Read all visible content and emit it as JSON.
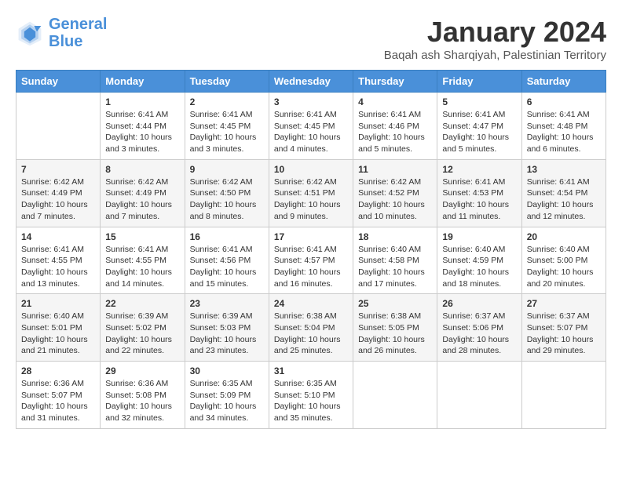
{
  "logo": {
    "line1": "General",
    "line2": "Blue"
  },
  "title": "January 2024",
  "location": "Baqah ash Sharqiyah, Palestinian Territory",
  "days_of_week": [
    "Sunday",
    "Monday",
    "Tuesday",
    "Wednesday",
    "Thursday",
    "Friday",
    "Saturday"
  ],
  "weeks": [
    [
      {
        "num": "",
        "info": ""
      },
      {
        "num": "1",
        "info": "Sunrise: 6:41 AM\nSunset: 4:44 PM\nDaylight: 10 hours\nand 3 minutes."
      },
      {
        "num": "2",
        "info": "Sunrise: 6:41 AM\nSunset: 4:45 PM\nDaylight: 10 hours\nand 3 minutes."
      },
      {
        "num": "3",
        "info": "Sunrise: 6:41 AM\nSunset: 4:45 PM\nDaylight: 10 hours\nand 4 minutes."
      },
      {
        "num": "4",
        "info": "Sunrise: 6:41 AM\nSunset: 4:46 PM\nDaylight: 10 hours\nand 5 minutes."
      },
      {
        "num": "5",
        "info": "Sunrise: 6:41 AM\nSunset: 4:47 PM\nDaylight: 10 hours\nand 5 minutes."
      },
      {
        "num": "6",
        "info": "Sunrise: 6:41 AM\nSunset: 4:48 PM\nDaylight: 10 hours\nand 6 minutes."
      }
    ],
    [
      {
        "num": "7",
        "info": "Sunrise: 6:42 AM\nSunset: 4:49 PM\nDaylight: 10 hours\nand 7 minutes."
      },
      {
        "num": "8",
        "info": "Sunrise: 6:42 AM\nSunset: 4:49 PM\nDaylight: 10 hours\nand 7 minutes."
      },
      {
        "num": "9",
        "info": "Sunrise: 6:42 AM\nSunset: 4:50 PM\nDaylight: 10 hours\nand 8 minutes."
      },
      {
        "num": "10",
        "info": "Sunrise: 6:42 AM\nSunset: 4:51 PM\nDaylight: 10 hours\nand 9 minutes."
      },
      {
        "num": "11",
        "info": "Sunrise: 6:42 AM\nSunset: 4:52 PM\nDaylight: 10 hours\nand 10 minutes."
      },
      {
        "num": "12",
        "info": "Sunrise: 6:41 AM\nSunset: 4:53 PM\nDaylight: 10 hours\nand 11 minutes."
      },
      {
        "num": "13",
        "info": "Sunrise: 6:41 AM\nSunset: 4:54 PM\nDaylight: 10 hours\nand 12 minutes."
      }
    ],
    [
      {
        "num": "14",
        "info": "Sunrise: 6:41 AM\nSunset: 4:55 PM\nDaylight: 10 hours\nand 13 minutes."
      },
      {
        "num": "15",
        "info": "Sunrise: 6:41 AM\nSunset: 4:55 PM\nDaylight: 10 hours\nand 14 minutes."
      },
      {
        "num": "16",
        "info": "Sunrise: 6:41 AM\nSunset: 4:56 PM\nDaylight: 10 hours\nand 15 minutes."
      },
      {
        "num": "17",
        "info": "Sunrise: 6:41 AM\nSunset: 4:57 PM\nDaylight: 10 hours\nand 16 minutes."
      },
      {
        "num": "18",
        "info": "Sunrise: 6:40 AM\nSunset: 4:58 PM\nDaylight: 10 hours\nand 17 minutes."
      },
      {
        "num": "19",
        "info": "Sunrise: 6:40 AM\nSunset: 4:59 PM\nDaylight: 10 hours\nand 18 minutes."
      },
      {
        "num": "20",
        "info": "Sunrise: 6:40 AM\nSunset: 5:00 PM\nDaylight: 10 hours\nand 20 minutes."
      }
    ],
    [
      {
        "num": "21",
        "info": "Sunrise: 6:40 AM\nSunset: 5:01 PM\nDaylight: 10 hours\nand 21 minutes."
      },
      {
        "num": "22",
        "info": "Sunrise: 6:39 AM\nSunset: 5:02 PM\nDaylight: 10 hours\nand 22 minutes."
      },
      {
        "num": "23",
        "info": "Sunrise: 6:39 AM\nSunset: 5:03 PM\nDaylight: 10 hours\nand 23 minutes."
      },
      {
        "num": "24",
        "info": "Sunrise: 6:38 AM\nSunset: 5:04 PM\nDaylight: 10 hours\nand 25 minutes."
      },
      {
        "num": "25",
        "info": "Sunrise: 6:38 AM\nSunset: 5:05 PM\nDaylight: 10 hours\nand 26 minutes."
      },
      {
        "num": "26",
        "info": "Sunrise: 6:37 AM\nSunset: 5:06 PM\nDaylight: 10 hours\nand 28 minutes."
      },
      {
        "num": "27",
        "info": "Sunrise: 6:37 AM\nSunset: 5:07 PM\nDaylight: 10 hours\nand 29 minutes."
      }
    ],
    [
      {
        "num": "28",
        "info": "Sunrise: 6:36 AM\nSunset: 5:07 PM\nDaylight: 10 hours\nand 31 minutes."
      },
      {
        "num": "29",
        "info": "Sunrise: 6:36 AM\nSunset: 5:08 PM\nDaylight: 10 hours\nand 32 minutes."
      },
      {
        "num": "30",
        "info": "Sunrise: 6:35 AM\nSunset: 5:09 PM\nDaylight: 10 hours\nand 34 minutes."
      },
      {
        "num": "31",
        "info": "Sunrise: 6:35 AM\nSunset: 5:10 PM\nDaylight: 10 hours\nand 35 minutes."
      },
      {
        "num": "",
        "info": ""
      },
      {
        "num": "",
        "info": ""
      },
      {
        "num": "",
        "info": ""
      }
    ]
  ]
}
